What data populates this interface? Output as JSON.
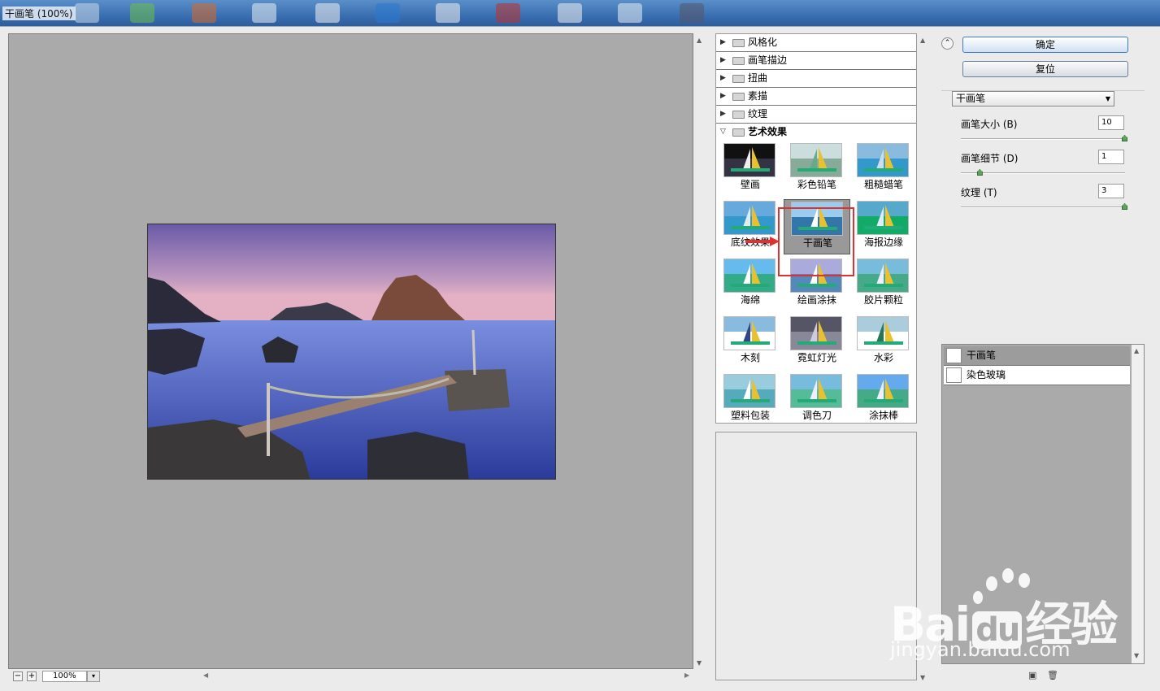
{
  "window": {
    "title": "干画笔 (100%)"
  },
  "preview": {
    "zoom": "100%",
    "zoom_out": "−",
    "zoom_in": "+",
    "zoom_drop": "▾"
  },
  "filter_categories": [
    {
      "label": "风格化",
      "expanded": false
    },
    {
      "label": "画笔描边",
      "expanded": false
    },
    {
      "label": "扭曲",
      "expanded": false
    },
    {
      "label": "素描",
      "expanded": false
    },
    {
      "label": "纹理",
      "expanded": false
    },
    {
      "label": "艺术效果",
      "expanded": true
    }
  ],
  "artistic_filters": [
    {
      "label": "壁画"
    },
    {
      "label": "彩色铅笔"
    },
    {
      "label": "粗糙蜡笔"
    },
    {
      "label": "底纹效果"
    },
    {
      "label": "干画笔",
      "selected": true
    },
    {
      "label": "海报边缘"
    },
    {
      "label": "海绵"
    },
    {
      "label": "绘画涂抹"
    },
    {
      "label": "胶片颗粒"
    },
    {
      "label": "木刻"
    },
    {
      "label": "霓虹灯光"
    },
    {
      "label": "水彩"
    },
    {
      "label": "塑料包装"
    },
    {
      "label": "调色刀"
    },
    {
      "label": "涂抹棒"
    }
  ],
  "buttons": {
    "ok": "确定",
    "reset": "复位",
    "collapse": "⌃"
  },
  "settings": {
    "filter_select": "干画笔",
    "params": [
      {
        "label": "画笔大小 (B)",
        "value": "10",
        "level": 1.0
      },
      {
        "label": "画笔细节 (D)",
        "value": "1",
        "level": 0.1
      },
      {
        "label": "纹理 (T)",
        "value": "3",
        "level": 1.0
      }
    ]
  },
  "layers": [
    {
      "name": "干画笔",
      "active": true
    },
    {
      "name": "染色玻璃",
      "active": false
    }
  ],
  "watermark": {
    "brand": "Bai",
    "brand2": "du",
    "cn": "经验",
    "url": "jingyan.baidu.com"
  },
  "colors": {
    "accent_red": "#e03030",
    "ok_border": "#3d7bc2"
  }
}
